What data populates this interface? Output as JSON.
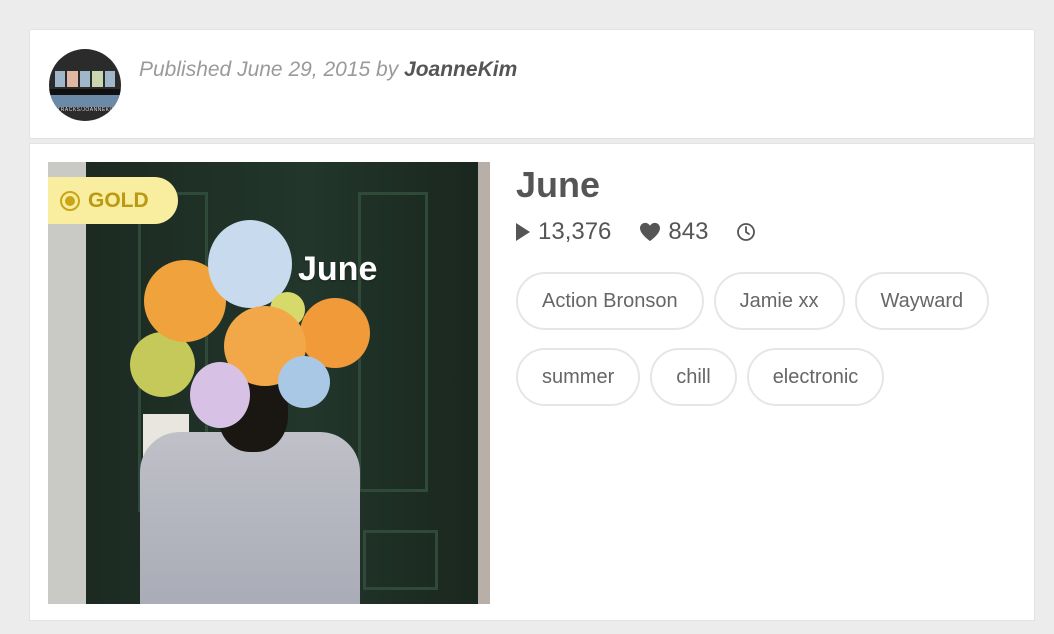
{
  "header": {
    "published_prefix": "Published June 29, 2015 by ",
    "author": "JoanneKim",
    "avatar_caption": "8TRACKS/JOANNEKIM"
  },
  "playlist": {
    "cover_text": "June",
    "badge": "GOLD",
    "title": "June",
    "plays": "13,376",
    "likes": "843",
    "tags_row1": [
      "Action Bronson",
      "Jamie xx",
      "Wayward"
    ],
    "tags_row2": [
      "summer",
      "chill",
      "electronic"
    ]
  },
  "colors": {
    "background": "#ececec",
    "badge_bg": "#f9eea0",
    "badge_text": "#b99a12",
    "text": "#555555"
  },
  "icons": [
    "play-icon",
    "heart-icon",
    "clock-icon",
    "gold-dot-icon"
  ]
}
